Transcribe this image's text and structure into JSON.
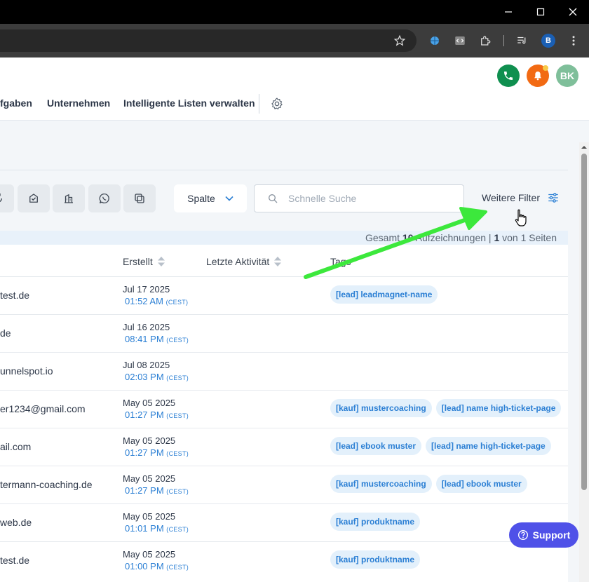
{
  "window": {
    "minimize_icon": "minimize-icon",
    "maximize_icon": "maximize-icon",
    "close_icon": "close-icon"
  },
  "browser": {
    "profile_initial": "B"
  },
  "header": {
    "avatar_initials": "BK",
    "phone_color": "#0f8f4f",
    "bell_color": "#f26a13",
    "avatar_color": "#7fbf9a",
    "nav": [
      {
        "label": "fgaben"
      },
      {
        "label": "Unternehmen"
      },
      {
        "label": "Intelligente Listen verwalten"
      }
    ]
  },
  "toolbar": {
    "spalte_label": "Spalte",
    "search_placeholder": "Schnelle Suche",
    "more_filters_label": "Weitere Filter"
  },
  "summary": {
    "prefix": "Gesamt",
    "count": "10",
    "records": "Aufzeichnungen |",
    "page": "1",
    "of": "von",
    "pages": "1",
    "pages_label": "Seiten"
  },
  "table": {
    "columns": {
      "created": "Erstellt",
      "last_activity": "Letzte Aktivität",
      "tags": "Tags"
    },
    "rows": [
      {
        "email": "test.de",
        "date": "Jul 17 2025",
        "time": "01:52 AM",
        "tz": "(CEST)",
        "tags": [
          "[lead] leadmagnet-name"
        ]
      },
      {
        "email": "de",
        "date": "Jul 16 2025",
        "time": "08:41 PM",
        "tz": "(CEST)",
        "tags": []
      },
      {
        "email": "unnelspot.io",
        "date": "Jul 08 2025",
        "time": "02:03 PM",
        "tz": "(CEST)",
        "tags": []
      },
      {
        "email": "er1234@gmail.com",
        "date": "May 05 2025",
        "time": "01:27 PM",
        "tz": "(CEST)",
        "tags": [
          "[kauf] mustercoaching",
          "[lead] name high-ticket-page"
        ]
      },
      {
        "email": "ail.com",
        "date": "May 05 2025",
        "time": "01:27 PM",
        "tz": "(CEST)",
        "tags": [
          "[lead] ebook muster",
          "[lead] name high-ticket-page"
        ]
      },
      {
        "email": "termann-coaching.de",
        "date": "May 05 2025",
        "time": "01:27 PM",
        "tz": "(CEST)",
        "tags": [
          "[kauf] mustercoaching",
          "[lead] ebook muster"
        ]
      },
      {
        "email": "web.de",
        "date": "May 05 2025",
        "time": "01:01 PM",
        "tz": "(CEST)",
        "tags": [
          "[kauf] produktname"
        ]
      },
      {
        "email": "test.de",
        "date": "May 05 2025",
        "time": "01:00 PM",
        "tz": "(CEST)",
        "tags": [
          "[kauf] produktname"
        ]
      }
    ]
  },
  "support": {
    "label": "Support"
  },
  "annotation": {
    "arrow_color": "#3ce83c"
  }
}
